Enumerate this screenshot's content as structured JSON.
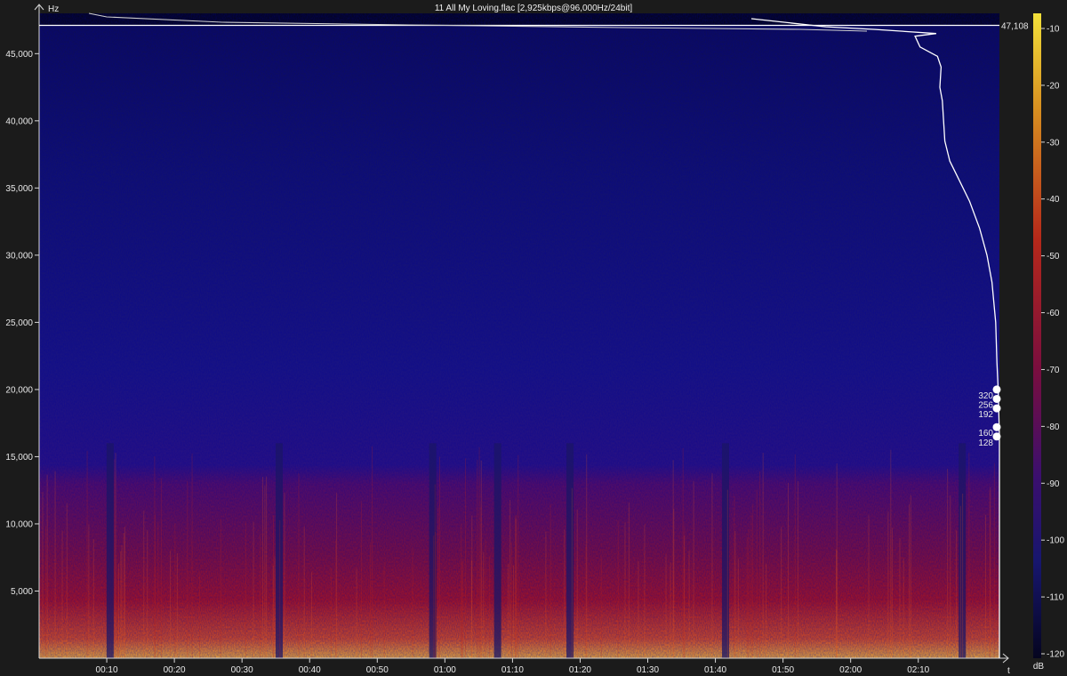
{
  "title": "11 All My Loving.flac [2,925kbps@96,000Hz/24bit]",
  "colors": {
    "background": "#1b1b1b",
    "axis": "#d8d8d8",
    "curve": "#ffffff",
    "spectrogram_low": "#0c0a3f",
    "spectrogram_mid": "#b41414",
    "spectrogram_high": "#f5a623"
  },
  "chart_data": {
    "type": "heatmap",
    "title": "11 All My Loving.flac [2,925kbps@96,000Hz/24bit]",
    "xlabel": "t",
    "ylabel": "Hz",
    "colorbar_label": "dB",
    "grid": false,
    "legend": "right (colorbar)",
    "x_range_seconds": [
      0,
      142
    ],
    "y_range_hz": [
      0,
      48000
    ],
    "x_ticks": [
      "00:10",
      "00:20",
      "00:30",
      "00:40",
      "00:50",
      "01:00",
      "01:10",
      "01:20",
      "01:30",
      "01:40",
      "01:50",
      "02:00",
      "02:10"
    ],
    "x_tick_seconds": [
      10,
      20,
      30,
      40,
      50,
      60,
      70,
      80,
      90,
      100,
      110,
      120,
      130
    ],
    "y_ticks": [
      "5,000",
      "10,000",
      "15,000",
      "20,000",
      "25,000",
      "30,000",
      "35,000",
      "40,000",
      "45,000"
    ],
    "y_tick_values": [
      5000,
      10000,
      15000,
      20000,
      25000,
      30000,
      35000,
      40000,
      45000
    ],
    "colorbar_ticks": [
      "-10",
      "-20",
      "-30",
      "-40",
      "-50",
      "-60",
      "-70",
      "-80",
      "-90",
      "-100",
      "-110",
      "-120"
    ],
    "colorbar_values": [
      -10,
      -20,
      -30,
      -40,
      -50,
      -60,
      -70,
      -80,
      -90,
      -100,
      -110,
      -120
    ],
    "cutoff_hz_label": "47,108",
    "cutoff_hz": 47108,
    "bitrate_markers": [
      {
        "label": "320",
        "hz": 20000
      },
      {
        "label": "256",
        "hz": 19300
      },
      {
        "label": "192",
        "hz": 18600
      },
      {
        "label": "160",
        "hz": 17200
      },
      {
        "label": "128",
        "hz": 16500
      }
    ],
    "spectrum_curve": {
      "description_units": "x = relative level 0..1 (right = louder), y = Hz",
      "points": [
        [
          1.0,
          0
        ],
        [
          1.0,
          5000
        ],
        [
          1.0,
          10000
        ],
        [
          1.0,
          15000
        ],
        [
          1.0,
          16500
        ],
        [
          0.995,
          20000
        ],
        [
          0.99,
          22000
        ],
        [
          0.985,
          25000
        ],
        [
          0.97,
          28000
        ],
        [
          0.95,
          30000
        ],
        [
          0.92,
          32000
        ],
        [
          0.88,
          34000
        ],
        [
          0.84,
          35500
        ],
        [
          0.8,
          37000
        ],
        [
          0.78,
          38500
        ],
        [
          0.775,
          40000
        ],
        [
          0.77,
          41500
        ],
        [
          0.76,
          42500
        ],
        [
          0.765,
          44000
        ],
        [
          0.75,
          44800
        ],
        [
          0.68,
          45500
        ],
        [
          0.66,
          46300
        ],
        [
          0.745,
          46500
        ],
        [
          0.5,
          46800
        ],
        [
          0.3,
          47000
        ],
        [
          0.0,
          47600
        ]
      ]
    },
    "loud_band_hz": 16000,
    "quiet_moments_seconds": [
      10.5,
      35.5,
      58.2,
      67.8,
      78.5,
      101.5,
      136.5
    ]
  }
}
